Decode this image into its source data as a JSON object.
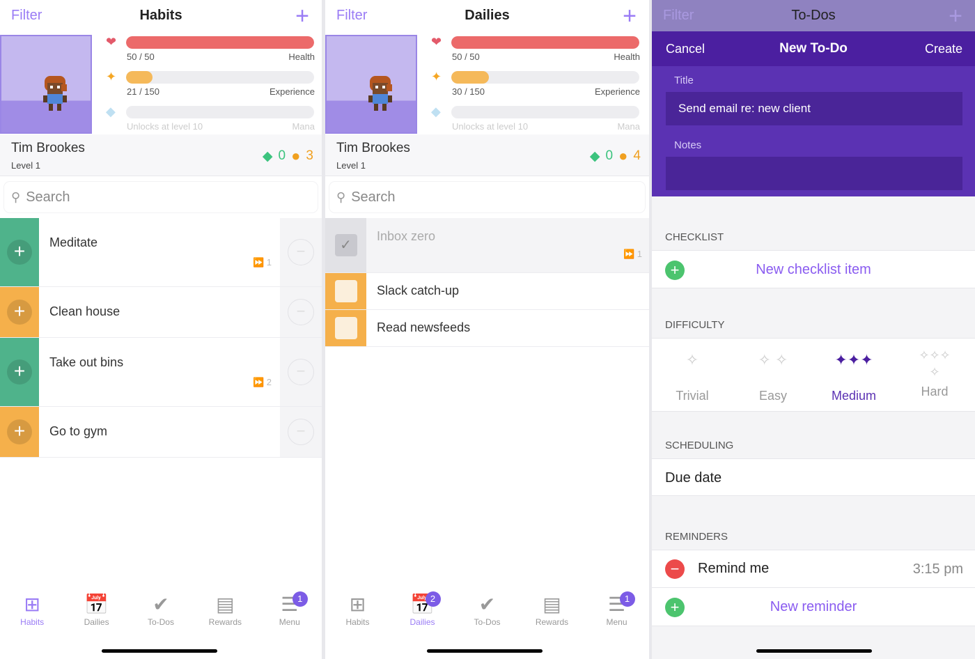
{
  "colors": {
    "accent": "#9a7cf5",
    "health": "#ec6a6a",
    "experience": "#f5b95a",
    "habit_green": "#4fb38b",
    "habit_orange": "#f5b04b",
    "purple_dark": "#4b1fa0"
  },
  "panels": [
    {
      "header": {
        "filter": "Filter",
        "title": "Habits",
        "add": "+"
      },
      "stats": {
        "health": {
          "value": "50 / 50",
          "label": "Health",
          "percent": 100
        },
        "experience": {
          "value": "21 / 150",
          "label": "Experience",
          "percent": 14
        },
        "mana": {
          "value": "Unlocks at level 10",
          "label": "Mana",
          "percent": 0
        }
      },
      "user": {
        "name": "Tim Brookes",
        "level": "Level 1",
        "gems": "0",
        "gold": "3"
      },
      "search_placeholder": "Search",
      "kind": "habits",
      "tasks": [
        {
          "title": "Meditate",
          "streak": "1",
          "color": "green"
        },
        {
          "title": "Clean house",
          "streak": "",
          "color": "orange"
        },
        {
          "title": "Take out bins",
          "streak": "2",
          "color": "green"
        },
        {
          "title": "Go to gym",
          "streak": "",
          "color": "orange"
        }
      ],
      "tabs": [
        {
          "label": "Habits",
          "icon": "habits-icon",
          "active": true
        },
        {
          "label": "Dailies",
          "icon": "calendar-icon"
        },
        {
          "label": "To-Dos",
          "icon": "check-circle-icon"
        },
        {
          "label": "Rewards",
          "icon": "chest-icon"
        },
        {
          "label": "Menu",
          "icon": "menu-icon",
          "badge": "1"
        }
      ]
    },
    {
      "header": {
        "filter": "Filter",
        "title": "Dailies",
        "add": "+"
      },
      "stats": {
        "health": {
          "value": "50 / 50",
          "label": "Health",
          "percent": 100
        },
        "experience": {
          "value": "30 / 150",
          "label": "Experience",
          "percent": 20
        },
        "mana": {
          "value": "Unlocks at level 10",
          "label": "Mana",
          "percent": 0
        }
      },
      "user": {
        "name": "Tim Brookes",
        "level": "Level 1",
        "gems": "0",
        "gold": "4"
      },
      "search_placeholder": "Search",
      "kind": "dailies",
      "tasks": [
        {
          "title": "Inbox zero",
          "streak": "1",
          "completed": true
        },
        {
          "title": "Slack catch-up",
          "streak": "",
          "completed": false
        },
        {
          "title": "Read newsfeeds",
          "streak": "",
          "completed": false
        }
      ],
      "tabs": [
        {
          "label": "Habits",
          "icon": "habits-icon"
        },
        {
          "label": "Dailies",
          "icon": "calendar-icon",
          "active": true,
          "badge": "2"
        },
        {
          "label": "To-Dos",
          "icon": "check-circle-icon"
        },
        {
          "label": "Rewards",
          "icon": "chest-icon"
        },
        {
          "label": "Menu",
          "icon": "menu-icon",
          "badge": "1"
        }
      ]
    }
  ],
  "todo": {
    "header": {
      "filter": "Filter",
      "title": "To-Dos",
      "add": "+"
    },
    "nav": {
      "cancel": "Cancel",
      "title": "New To-Do",
      "create": "Create"
    },
    "title_label": "Title",
    "title_value": "Send email re: new client",
    "notes_label": "Notes",
    "notes_value": "",
    "checklist_header": "CHECKLIST",
    "new_checklist": "New checklist item",
    "difficulty_header": "DIFFICULTY",
    "difficulties": [
      {
        "label": "Trivial",
        "stars": "✧"
      },
      {
        "label": "Easy",
        "stars": "✧ ✧"
      },
      {
        "label": "Medium",
        "stars": "✦✦✦",
        "selected": true
      },
      {
        "label": "Hard",
        "stars": "✧✧✧✧"
      }
    ],
    "scheduling_header": "SCHEDULING",
    "due_date": "Due date",
    "reminders_header": "REMINDERS",
    "remind_me": "Remind me",
    "remind_time": "3:15 pm",
    "new_reminder": "New reminder"
  }
}
